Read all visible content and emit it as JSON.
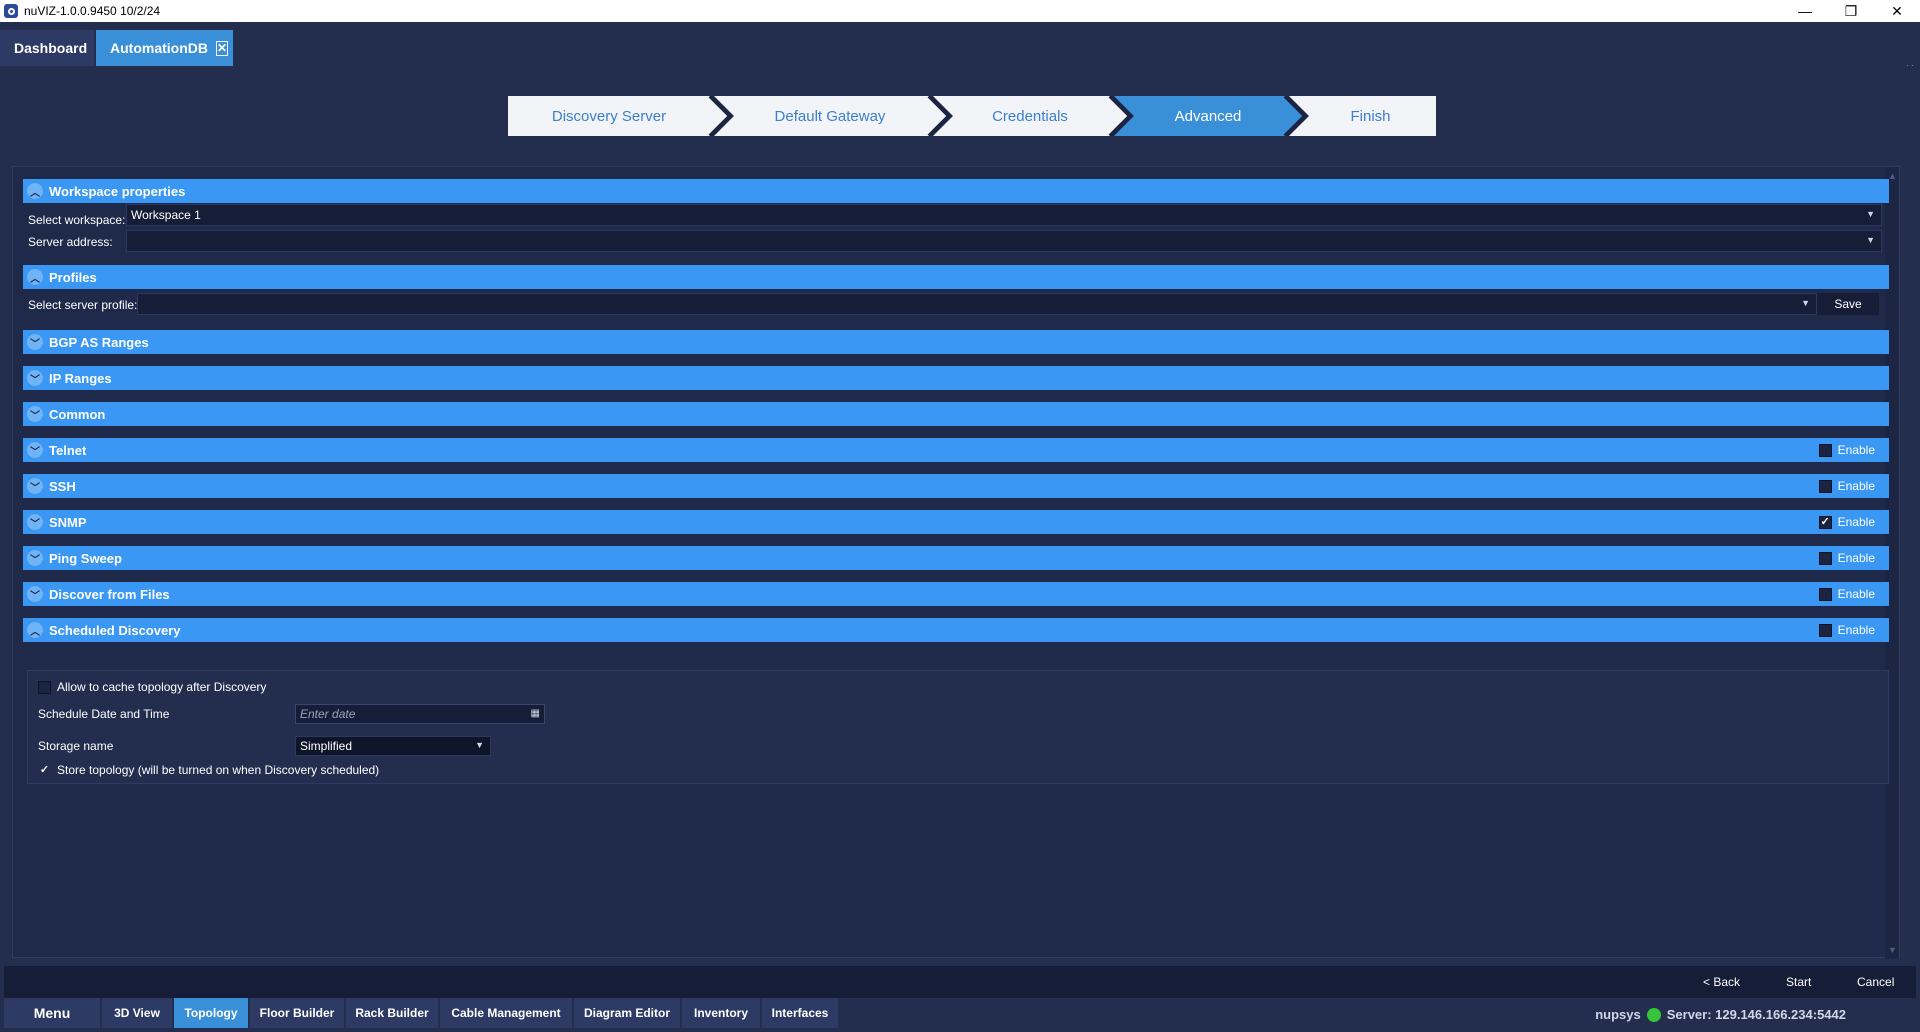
{
  "window": {
    "title": "nuVIZ-1.0.0.9450 10/2/24",
    "controls": {
      "minimize": "—",
      "restore": "❐",
      "close": "✕"
    }
  },
  "doc_tabs": [
    {
      "label": "Dashboard"
    },
    {
      "label": "AutomationDB",
      "close": "✕"
    }
  ],
  "panel_close": "×",
  "wizard": {
    "steps": [
      {
        "label": "Discovery Server"
      },
      {
        "label": "Default Gateway"
      },
      {
        "label": "Credentials"
      },
      {
        "label": "Advanced",
        "active": true
      },
      {
        "label": "Finish"
      }
    ]
  },
  "sections": {
    "workspace": {
      "title": "Workspace properties",
      "select_workspace_label": "Select workspace:",
      "select_workspace_value": "Workspace 1",
      "server_address_label": "Server address:",
      "server_address_value": ""
    },
    "profiles": {
      "title": "Profiles",
      "select_profile_label": "Select server profile:",
      "select_profile_value": "",
      "save_label": "Save"
    },
    "bgp": {
      "title": "BGP AS Ranges"
    },
    "ip": {
      "title": "IP Ranges"
    },
    "common": {
      "title": "Common"
    },
    "telnet": {
      "title": "Telnet",
      "enable_label": "Enable",
      "enabled": false
    },
    "ssh": {
      "title": "SSH",
      "enable_label": "Enable",
      "enabled": false
    },
    "snmp": {
      "title": "SNMP",
      "enable_label": "Enable",
      "enabled": true
    },
    "ping": {
      "title": "Ping Sweep",
      "enable_label": "Enable",
      "enabled": false
    },
    "files": {
      "title": "Discover from Files",
      "enable_label": "Enable",
      "enabled": false
    },
    "scheduled": {
      "title": "Scheduled Discovery",
      "enable_label": "Enable",
      "enabled": false,
      "allow_cache_label": "Allow to cache topology after Discovery",
      "allow_cache_checked": false,
      "schedule_label": "Schedule Date and Time",
      "schedule_placeholder": "Enter date",
      "storage_label": "Storage name",
      "storage_value": "Simplified",
      "store_topology_label": "Store topology (will be turned on when Discovery scheduled)",
      "store_topology_checked": true
    }
  },
  "actions": {
    "back": "< Back",
    "start": "Start",
    "cancel": "Cancel"
  },
  "taskbar": {
    "menu": "Menu",
    "tabs": [
      "3D View",
      "Topology",
      "Floor Builder",
      "Rack Builder",
      "Cable Management",
      "Diagram Editor",
      "Inventory",
      "Interfaces"
    ],
    "active_tab": "Topology",
    "user": "nupsys",
    "server": "Server: 129.146.166.234:5442",
    "status_color": "#35c43a"
  },
  "colors": {
    "accent": "#3a97f3",
    "background": "#232e4f",
    "active_tab": "#3a8fd9"
  }
}
